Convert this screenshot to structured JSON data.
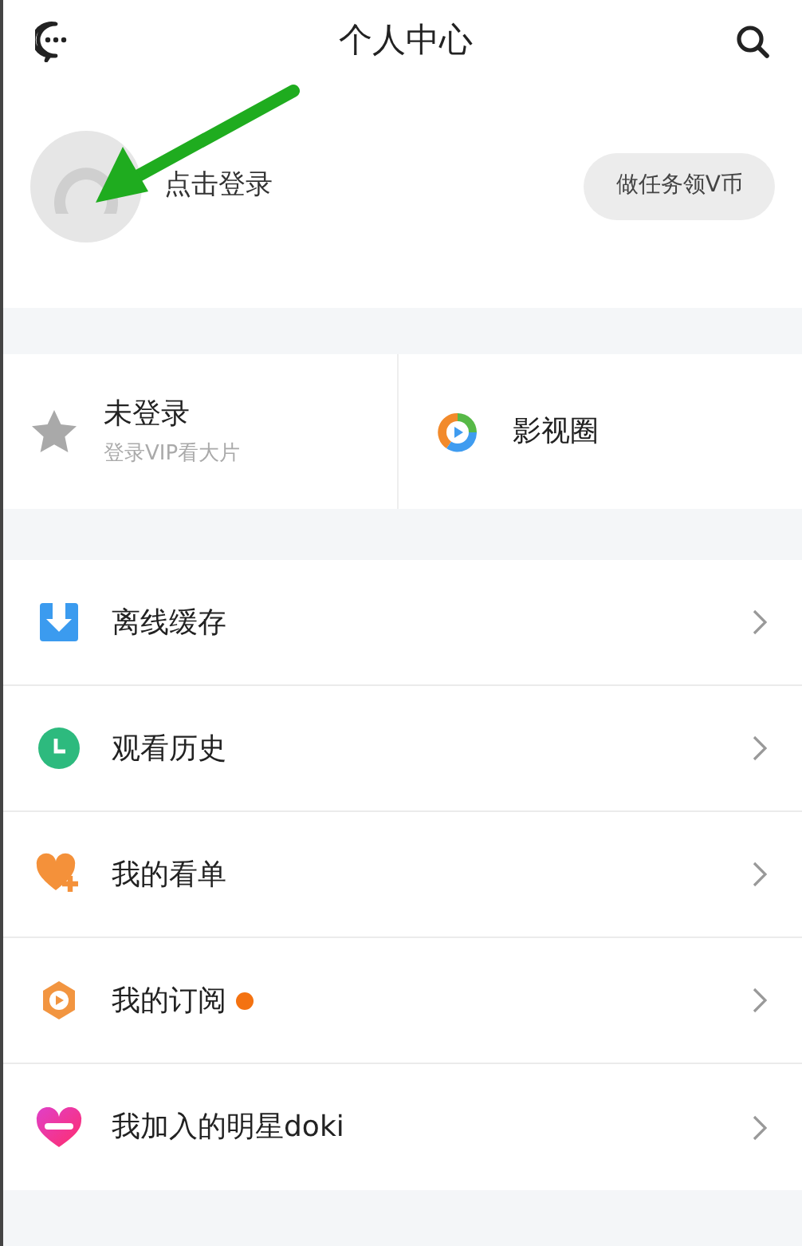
{
  "header": {
    "title": "个人中心"
  },
  "profile": {
    "login_label": "点击登录",
    "task_button": "做任务领V币"
  },
  "cards": [
    {
      "kind": "vip",
      "title": "未登录",
      "subtitle": "登录VIP看大片"
    },
    {
      "kind": "circle",
      "title": "影视圈"
    }
  ],
  "menu": [
    {
      "kind": "download",
      "label": "离线缓存",
      "dot": false
    },
    {
      "kind": "history",
      "label": "观看历史",
      "dot": false
    },
    {
      "kind": "watchlist",
      "label": "我的看单",
      "dot": false
    },
    {
      "kind": "subscribe",
      "label": "我的订阅",
      "dot": true
    },
    {
      "kind": "doki",
      "label": "我加入的明星doki",
      "dot": false
    }
  ]
}
